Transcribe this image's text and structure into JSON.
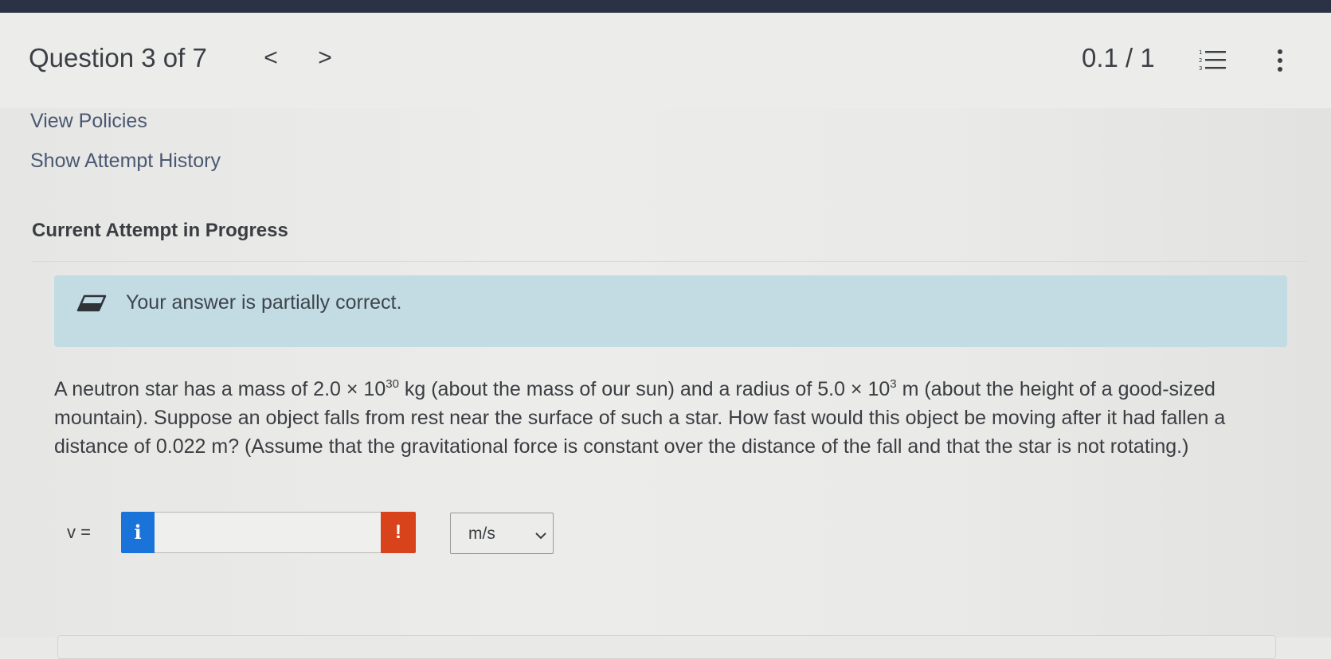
{
  "header": {
    "title": "Question 3 of 7",
    "prev_label": "<",
    "next_label": ">",
    "score": "0.1 / 1",
    "list_icon": "numbered-list-icon",
    "menu_icon": "vertical-dots-icon"
  },
  "links": {
    "view_policies": "View Policies",
    "show_attempt_history": "Show Attempt History"
  },
  "attempt": {
    "heading": "Current Attempt in Progress"
  },
  "feedback": {
    "icon": "eraser-icon",
    "text": "Your answer is partially correct."
  },
  "question": {
    "t1": "A neutron star has a mass of 2.0 × 10",
    "mass_exp": "30",
    "t2": " kg (about the mass of our sun) and a radius of 5.0 × 10",
    "radius_exp": "3",
    "t3": " m (about the height of a good-sized mountain). Suppose an object falls from rest near the surface of such a star. How fast would this object be moving after it had fallen a distance of 0.022 m? (Assume that the gravitational force is constant over the distance of the fall and that the star is not rotating.)"
  },
  "answer": {
    "label": "v =",
    "info_label": "i",
    "value": "",
    "warning_label": "!",
    "unit_selected": "m/s"
  },
  "colors": {
    "info_button": "#1a73d9",
    "warning_button": "#d8431c",
    "feedback_banner": "#c3dce4",
    "top_bar": "#2b3245"
  }
}
